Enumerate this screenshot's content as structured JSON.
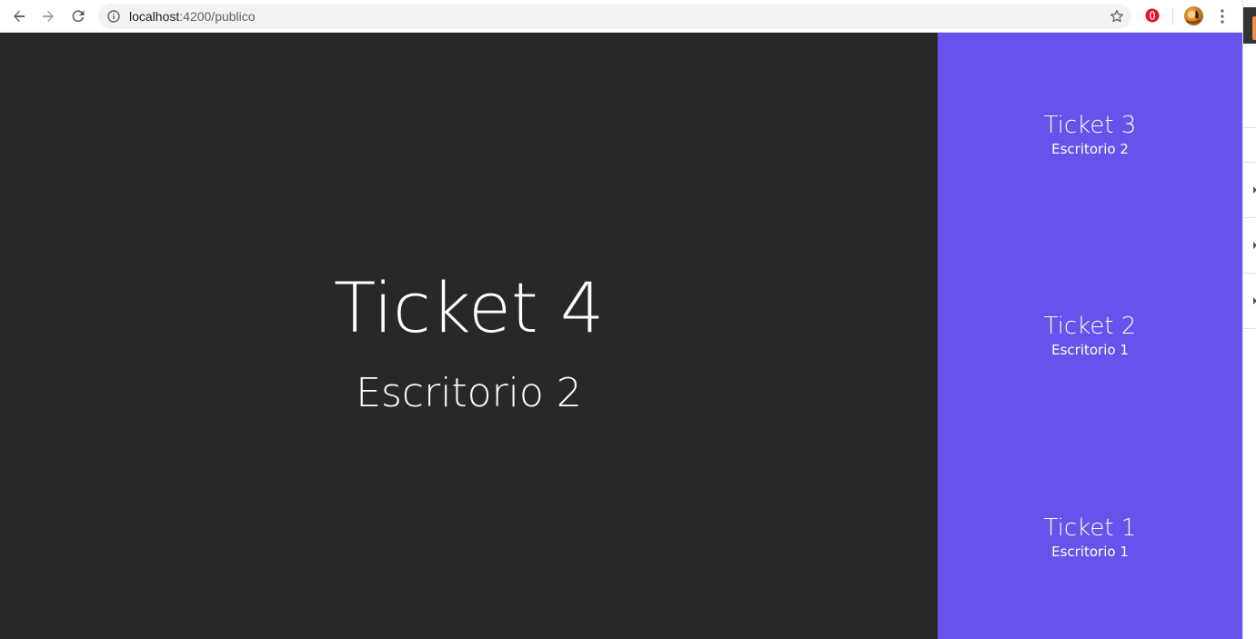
{
  "browser": {
    "url_host": "localhost",
    "url_rest": ":4200/publico",
    "icons": [
      "back-icon",
      "forward-icon",
      "reload-icon",
      "info-icon",
      "star-icon",
      "opera-icon",
      "avatar",
      "menu-icon"
    ]
  },
  "main": {
    "ticket": "Ticket 4",
    "desk": "Escritorio 2"
  },
  "queue": [
    {
      "ticket": "Ticket 3",
      "desk": "Escritorio 2"
    },
    {
      "ticket": "Ticket 2",
      "desk": "Escritorio 1"
    },
    {
      "ticket": "Ticket 1",
      "desk": "Escritorio 1"
    }
  ],
  "colors": {
    "main_bg": "#282828",
    "side_bg": "#6852ec",
    "text": "#ffffff"
  }
}
